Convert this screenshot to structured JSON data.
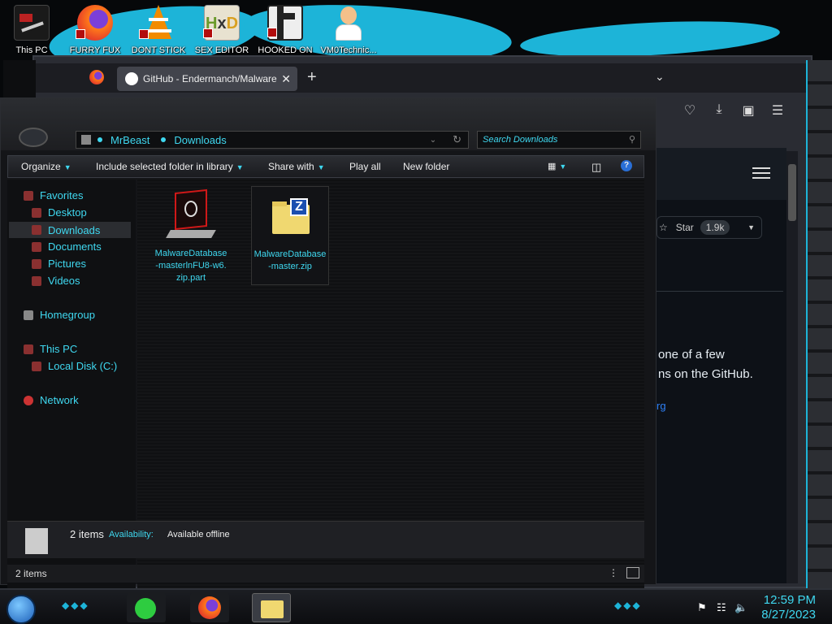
{
  "desktop_icons": [
    {
      "label": "This PC",
      "icon": "computer-icon"
    },
    {
      "label": "FURRY FUX",
      "icon": "firefox-icon"
    },
    {
      "label": "DONT STICK",
      "icon": "vlc-icon"
    },
    {
      "label": "SEX EDITOR",
      "icon": "hex-editor-icon"
    },
    {
      "label": "HOOKED ON",
      "icon": "app-icon"
    },
    {
      "label": "VM0Technic...",
      "icon": "doctor-icon"
    }
  ],
  "browser": {
    "tab_title": "GitHub - Endermanch/Malware",
    "new_tab": "+",
    "close_tab": "✕",
    "star_label": "Star",
    "star_count": "1.9k",
    "text_line1": "one of a few",
    "text_line2": "ns on the GitHub.",
    "link_text": "rg"
  },
  "explorer": {
    "breadcrumb": [
      "MrBeast",
      "Downloads"
    ],
    "search_placeholder": "Search Downloads",
    "toolbar": {
      "organize": "Organize",
      "include": "Include selected folder in library",
      "share": "Share with",
      "play": "Play all",
      "newfolder": "New folder"
    },
    "nav": {
      "favorites": "Favorites",
      "desktop": "Desktop",
      "downloads": "Downloads",
      "documents": "Documents",
      "pictures": "Pictures",
      "videos": "Videos",
      "homegroup": "Homegroup",
      "thispc": "This PC",
      "localdisk": "Local Disk (C:)",
      "network": "Network"
    },
    "files": [
      {
        "name_line1": "MalwareDatabase",
        "name_line2": "-masterlnFU8-w6.",
        "name_line3": "zip.part",
        "icon": "alienware-file-icon"
      },
      {
        "name_line1": "MalwareDatabase",
        "name_line2": "-master.zip",
        "icon": "zip-folder-icon"
      }
    ],
    "details": {
      "count": "2 items",
      "availability_label": "Availability:",
      "availability_value": "Available offline"
    },
    "status": "2 items"
  },
  "taskbar": {
    "time": "12:59 PM",
    "date": "8/27/2023"
  },
  "colors": {
    "accent": "#3fd8f0",
    "wallpaper_cyan": "#1db4d8"
  }
}
